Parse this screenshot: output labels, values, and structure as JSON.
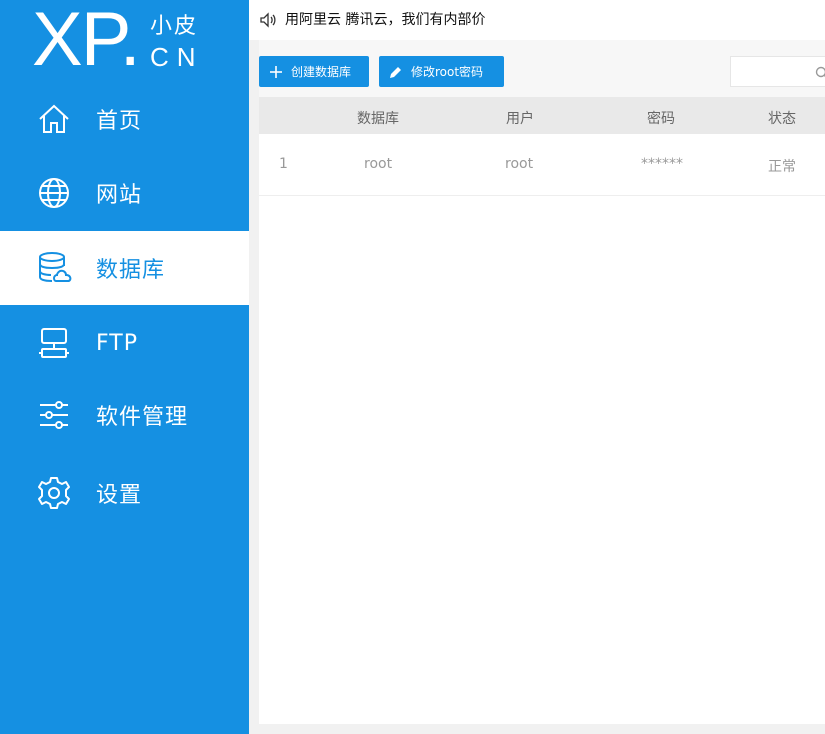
{
  "logo": {
    "main": "XP.",
    "cn_top": "小皮",
    "cn_bottom": "CN"
  },
  "sidebar": {
    "items": [
      {
        "label": "首页",
        "icon": "home-icon",
        "active": false
      },
      {
        "label": "网站",
        "icon": "globe-icon",
        "active": false
      },
      {
        "label": "数据库",
        "icon": "database-icon",
        "active": true
      },
      {
        "label": "FTP",
        "icon": "ftp-icon",
        "active": false
      },
      {
        "label": "软件管理",
        "icon": "sliders-icon",
        "active": false
      },
      {
        "label": "设置",
        "icon": "gear-icon",
        "active": false
      }
    ]
  },
  "notice": {
    "icon": "speaker-icon",
    "text": "用阿里云 腾讯云，我们有内部价"
  },
  "toolbar": {
    "create_label": "创建数据库",
    "root_pwd_label": "修改root密码",
    "search_placeholder": ""
  },
  "table": {
    "columns": [
      "",
      "数据库",
      "用户",
      "密码",
      "状态"
    ],
    "rows": [
      {
        "index": "1",
        "database": "root",
        "user": "root",
        "password": "******",
        "status": "正常"
      }
    ]
  },
  "colors": {
    "brand": "#1590e2",
    "sidebar_bg": "#1590e2",
    "active_bg": "#ffffff"
  }
}
